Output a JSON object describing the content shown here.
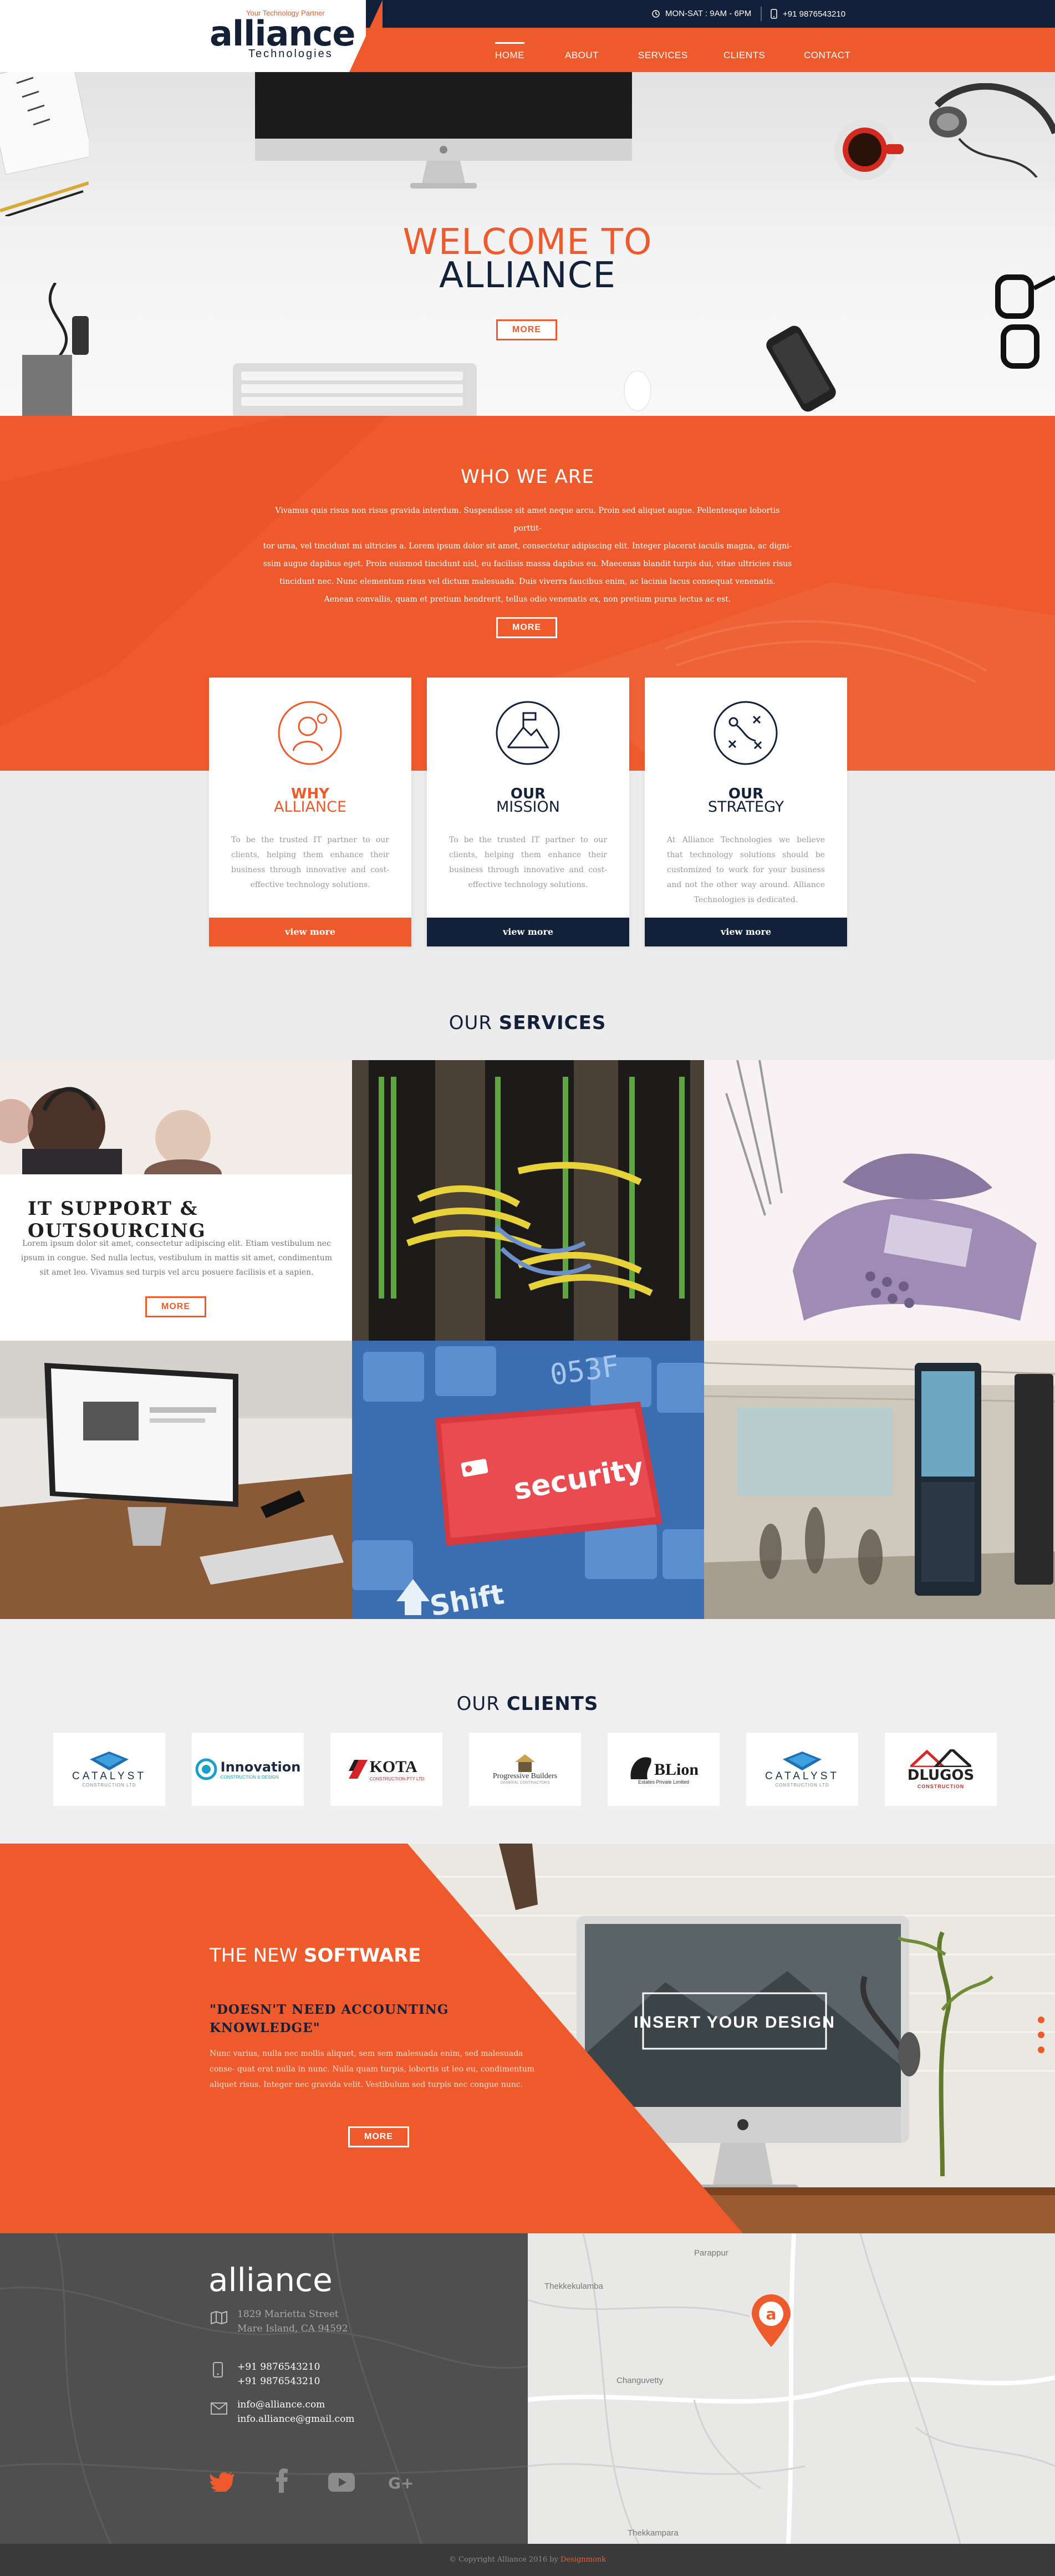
{
  "header": {
    "logo_word": "alliance",
    "logo_tagline": "Your Technology Partner",
    "logo_sub": "Technologies",
    "hours": "MON-SAT : 9AM - 6PM",
    "phone": "+91 9876543210",
    "nav": [
      "HOME",
      "ABOUT",
      "SERVICES",
      "CLIENTS",
      "CONTACT"
    ],
    "active_nav": "HOME"
  },
  "hero": {
    "line1": "WELCOME TO",
    "line2": "ALLIANCE",
    "button": "MORE"
  },
  "who": {
    "title": "WHO WE ARE",
    "lines": [
      "Vivamus quis risus non risus gravida interdum. Suspendisse sit amet neque arcu. Proin sed aliquet augue. Pellentesque lobortis porttit-",
      "tor urna, vel tincidunt mi ultricies a. Lorem ipsum dolor sit amet, consectetur adipiscing elit. Integer placerat iaculis magna, ac digni-",
      "ssim augue dapibus eget. Proin euismod tincidunt nisl, eu facilisis massa dapibus eu. Maecenas blandit turpis dui, vitae ultricies risus",
      "tincidunt nec. Nunc elementum risus vel dictum malesuada. Duis viverra faucibus enim, ac lacinia lacus consequat venenatis.",
      "Aenean convallis, quam et pretium hendrerit, tellus odio venenatis ex, non pretium purus lectus ac est."
    ],
    "button": "MORE"
  },
  "cards": [
    {
      "title1": "WHY",
      "title2": "ALLIANCE",
      "icon": "person-idea-icon",
      "text": "To be the trusted IT partner to our clients, helping them enhance their business through innovative and cost-effective technology solutions.",
      "button": "view more"
    },
    {
      "title1": "OUR",
      "title2": "MISSION",
      "icon": "mountain-flag-icon",
      "text": "To be the trusted IT partner to our clients, helping them enhance their business through innovative and cost-effective technology solutions.",
      "button": "view more"
    },
    {
      "title1": "OUR",
      "title2": "STRATEGY",
      "icon": "strategy-play-icon",
      "text": "At Alliance Technologies we believe that technology solutions should be customized to work for your business and not the other way around. Alliance Technologies is dedicated.",
      "button": "view more"
    }
  ],
  "services": {
    "title_light": "OUR",
    "title_bold": "SERVICES",
    "featured_title": "IT SUPPORT & OUTSOURCING",
    "featured_text": "Lorem ipsum dolor sit amet, consectetur adipiscing elit. Etiam vestibulum nec ipsum in congue. Sed nulla lectus, vestibulum in mattis sit amet, condimentum sit amet leo. Vivamus sed turpis vel arcu posuere facilisis et a sapien.",
    "featured_button": "MORE",
    "keyboard_text": "security",
    "shift_text": "Shift",
    "key_letters": "053F"
  },
  "clients": {
    "title_light": "OUR",
    "title_bold": "CLIENTS",
    "logos": [
      {
        "name": "CATALYST",
        "sub": "CONSTRUCTION LTD"
      },
      {
        "name": "Innovation",
        "sub": "CONSTRUCTION & DESIGN"
      },
      {
        "name": "KOTA",
        "sub": "CONSTRUCTION PTY LTD"
      },
      {
        "name": "Progressive Builders",
        "sub": "GENERAL CONTRACTORS"
      },
      {
        "name": "BLion",
        "sub": "Estates Private Limited"
      },
      {
        "name": "CATALYST",
        "sub": "CONSTRUCTION LTD"
      },
      {
        "name": "DLUGOS",
        "sub": "CONSTRUCTION"
      }
    ]
  },
  "software": {
    "title_light": "THE NEW",
    "title_bold": "SOFTWARE",
    "quote_line1": "\"DOESN'T NEED ACCOUNTING",
    "quote_line2": "KNOWLEDGE\"",
    "text": "Nunc varius, nulla nec mollis aliquet, sem sem malesuada enim, sed malesuada conse- quat erat nulla in nunc. Nulla quam turpis, lobortis ut leo eu, condimentum aliquet risus. Integer nec gravida velit. Vestibulum sed turpis nec congue nunc.",
    "button": "MORE",
    "screen_text": "INSERT YOUR DESIGN"
  },
  "footer": {
    "logo_word": "alliance",
    "address_line1": "1829 Marietta Street",
    "address_line2": "Mare Island, CA 94592",
    "phone1": "+91 9876543210",
    "phone2": "+91 9876543210",
    "email1": "info@alliance.com",
    "email2": "info.alliance@gmail.com",
    "copyright": "© Copyright Alliance 2016 by",
    "copyright_brand": "Designmonk",
    "map_labels": {
      "place1": "Parappur",
      "place2": "Thekkekulamba",
      "place3": "Changuvetty",
      "place4": "Thekkampara"
    }
  },
  "colors": {
    "orange": "#ef5a2d",
    "navy": "#132039",
    "footer_gray": "#4f4f4f",
    "light_gray": "#ececec"
  }
}
